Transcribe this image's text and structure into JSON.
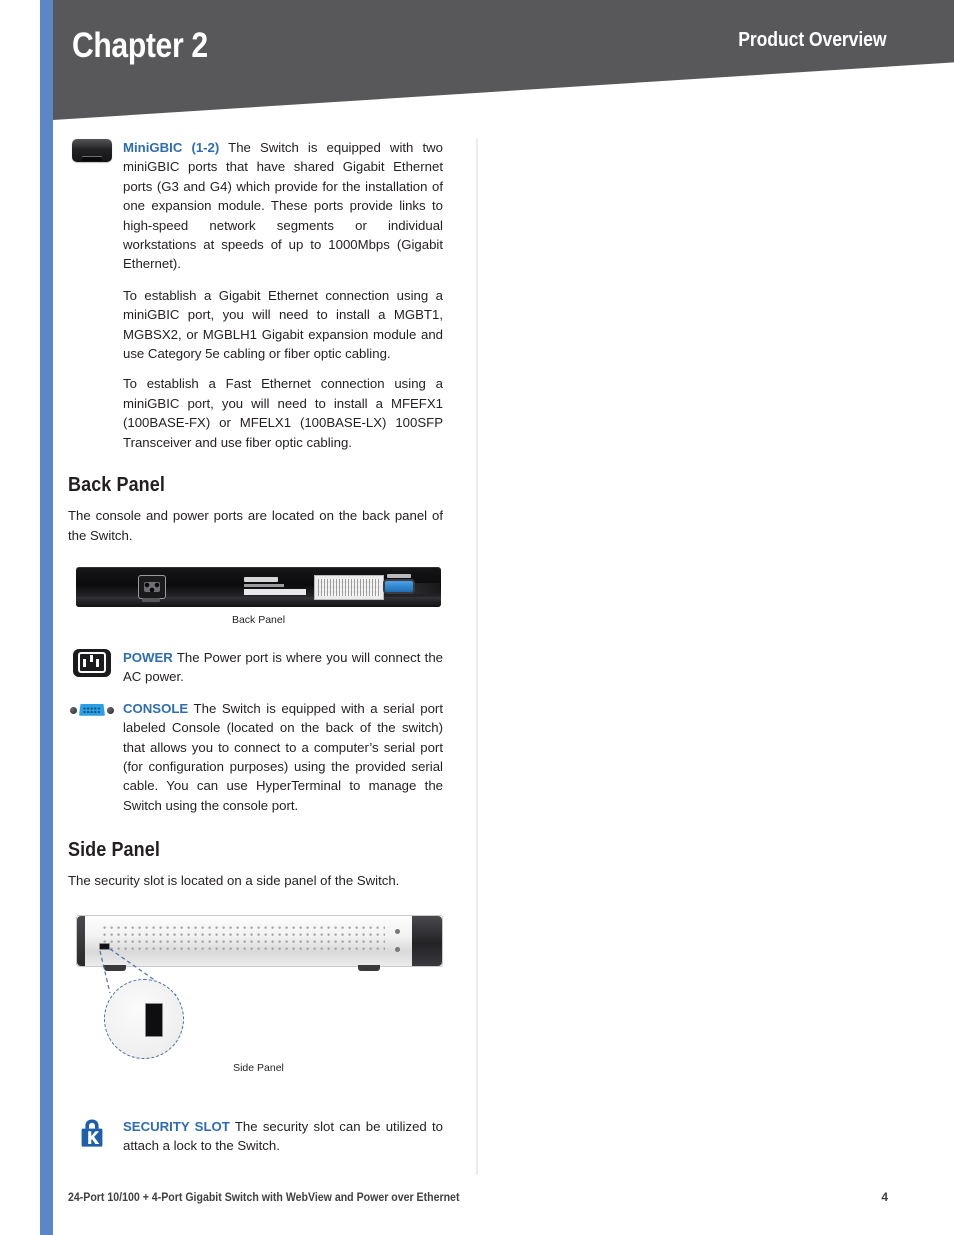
{
  "header": {
    "chapter": "Chapter 2",
    "section_title": "Product Overview"
  },
  "colors": {
    "banner": "#58585a",
    "left_stripe": "#5b87c7",
    "lead_blue": "#2e6db4",
    "divider": "#eaecf4"
  },
  "body": {
    "minigbic": {
      "icon": "minigbic-port-icon",
      "lead": "MiniGBIC (1-2)",
      "text": " The Switch is equipped with two miniGBIC ports that have shared Gigabit Ethernet ports (G3 and G4) which provide for the installation of one expansion module. These ports provide links to high-speed network segments or individual workstations at speeds of up to 1000Mbps (Gigabit Ethernet).",
      "para2": "To establish a Gigabit Ethernet connection using a miniGBIC port, you will need to install a MGBT1, MGBSX2, or MGBLH1 Gigabit expansion module and use Category 5e cabling or fiber optic cabling.",
      "para3": "To establish a Fast Ethernet connection using a miniGBIC port, you will need to install a MFEFX1 (100BASE-FX) or MFELX1 (100BASE-LX) 100SFP Transceiver and use fiber optic cabling."
    },
    "back_panel": {
      "heading": "Back Panel",
      "intro": "The console and power ports are located on the back panel of the Switch.",
      "figure_caption": "Back Panel",
      "power": {
        "icon": "power-port-icon",
        "lead": "POWER",
        "text": " The Power port is where you will connect the AC power."
      },
      "console": {
        "icon": "console-port-icon",
        "lead": "CONSOLE",
        "text": " The Switch is equipped with a serial port labeled Console (located on the back of the switch) that allows you to connect to a computer’s serial port (for configuration purposes) using the provided serial cable. You can use HyperTerminal to manage the Switch using the console port."
      }
    },
    "side_panel": {
      "heading": "Side Panel",
      "intro": "The security slot is located on a side panel of the Switch.",
      "figure_caption": "Side Panel",
      "security_slot": {
        "icon": "kensington-lock-icon",
        "lead": "SECURITY SLOT",
        "text": " The security slot can be utilized to attach a lock to the Switch."
      }
    }
  },
  "footer": {
    "document_title": "24-Port 10/100 + 4-Port Gigabit Switch with WebView and Power over Ethernet",
    "page_number": "4"
  }
}
